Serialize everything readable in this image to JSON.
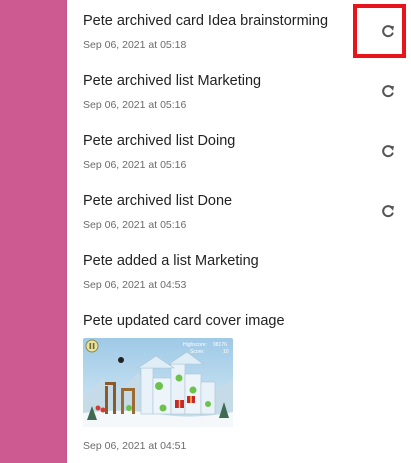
{
  "activity": {
    "items": [
      {
        "text": "Pete archived card Idea brainstorming",
        "date": "Sep 06, 2021 at 05:18"
      },
      {
        "text": "Pete archived list Marketing",
        "date": "Sep 06, 2021 at 05:16"
      },
      {
        "text": "Pete archived list Doing",
        "date": "Sep 06, 2021 at 05:16"
      },
      {
        "text": "Pete archived list Done",
        "date": "Sep 06, 2021 at 05:16"
      },
      {
        "text": "Pete added a list Marketing",
        "date": "Sep 06, 2021 at 04:53"
      },
      {
        "text": "Pete updated card cover image",
        "date": "Sep 06, 2021 at 04:51"
      }
    ],
    "cover_image": {
      "highscore_label": "Highscore:",
      "highscore_value": "98176",
      "score_label": "Score:",
      "score_value": "10"
    }
  },
  "icons": {
    "restore": "restore-icon"
  },
  "colors": {
    "sidebar": "#cd5a91",
    "highlight": "#e8141c",
    "icon": "#555555"
  }
}
